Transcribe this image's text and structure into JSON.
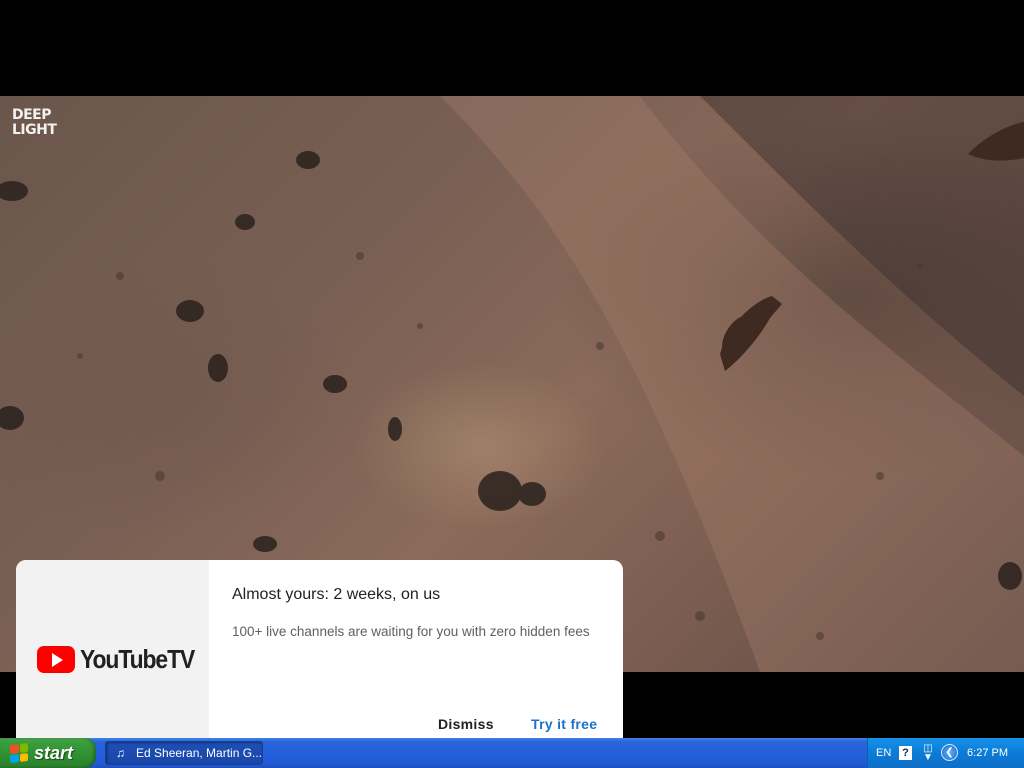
{
  "video": {
    "watermark_line1": "DEEP",
    "watermark_line2": "LIGHT"
  },
  "promo": {
    "brand": "YouTubeTV",
    "headline": "Almost yours: 2 weeks, on us",
    "subtext": "100+ live channels are waiting for you with zero hidden fees",
    "dismiss_label": "Dismiss",
    "try_label": "Try it free",
    "colors": {
      "brand_red": "#ff0000",
      "action_blue": "#1a73c8"
    }
  },
  "taskbar": {
    "start_label": "start",
    "window_button_label": "Ed Sheeran, Martin G...",
    "window_button_icon": "media-player-icon",
    "language": "EN",
    "help_glyph": "?",
    "clock": "6:27 PM"
  }
}
